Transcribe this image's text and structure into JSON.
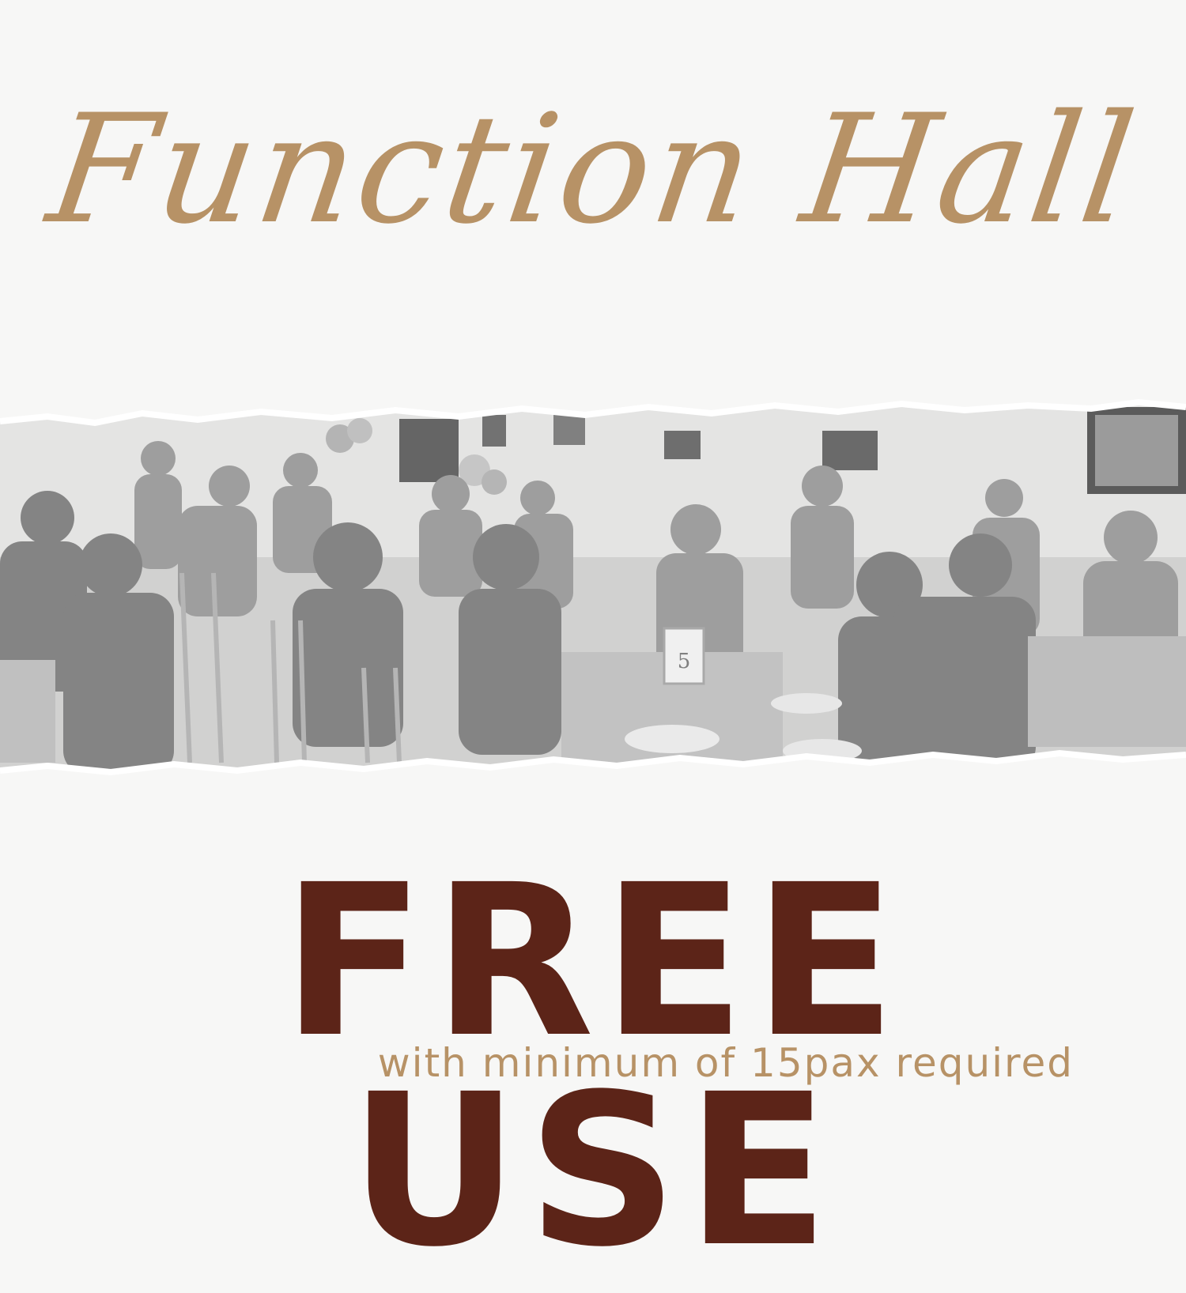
{
  "title": "Function Hall",
  "headline": "FREE USE",
  "subline": "with minimum of 15pax required",
  "photo": {
    "table_number": "5"
  },
  "colors": {
    "background": "#f7f7f6",
    "gold": "#b79266",
    "brown": "#5c2418"
  }
}
